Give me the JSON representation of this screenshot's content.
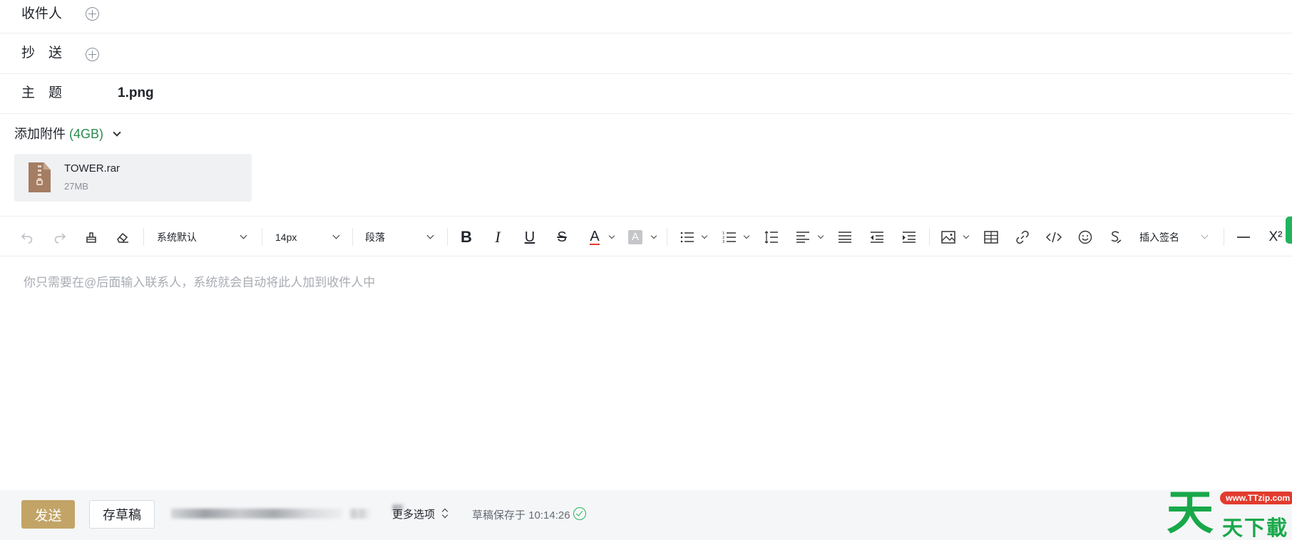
{
  "recipients": {
    "to_label": "收件人",
    "cc_label": "抄　送",
    "subject_label": "主　题",
    "subject_value": "1.png"
  },
  "attachments": {
    "add_label": "添加附件",
    "quota": "(4GB)",
    "files": [
      {
        "name": "TOWER.rar",
        "size": "27MB",
        "icon": "archive-icon"
      }
    ]
  },
  "toolbar": {
    "font_family": "系统默认",
    "font_size": "14px",
    "block_format": "段落",
    "bold": "B",
    "italic": "I",
    "underline": "U",
    "strike": "S",
    "font_color": "A",
    "bg_color": "A",
    "insert_signature": "插入签名",
    "superscript": "X²",
    "icons": [
      "undo-icon",
      "redo-icon",
      "format-painter-icon",
      "eraser-icon",
      "bullet-list-icon",
      "numbered-list-icon",
      "line-height-icon",
      "align-left-icon",
      "justify-icon",
      "outdent-icon",
      "indent-icon",
      "image-icon",
      "table-icon",
      "link-icon",
      "code-icon",
      "emoji-icon",
      "signature-icon",
      "horizontal-rule-icon"
    ],
    "font_color_underline": "#e23b2e"
  },
  "editor": {
    "placeholder": "你只需要在@后面输入联系人，系统就会自动将此人加到收件人中"
  },
  "footer": {
    "send_label": "发送",
    "save_draft_label": "存草稿",
    "more_options_label": "更多选项",
    "draft_saved_text": "草稿保存于 10:14:26"
  },
  "watermark": {
    "glyph": "天",
    "url": "www.TTzip.com",
    "name": "天下載"
  },
  "colors": {
    "send_button": "#c3a467",
    "accent_green": "#22b35e",
    "quota_green": "#2a8c4d"
  }
}
